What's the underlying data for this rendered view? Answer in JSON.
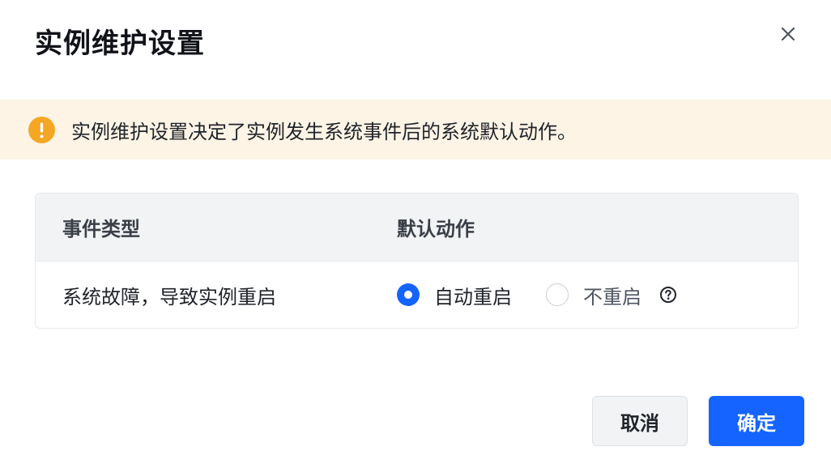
{
  "dialog": {
    "title": "实例维护设置",
    "close_icon": "close-icon"
  },
  "alert": {
    "icon": "warning-icon",
    "color": "#f5a623",
    "background": "#fdf4e6",
    "text": "实例维护设置决定了实例发生系统事件后的系统默认动作。"
  },
  "table": {
    "headers": [
      "事件类型",
      "默认动作"
    ],
    "rows": [
      {
        "event_type": "系统故障，导致实例重启",
        "options": [
          {
            "label": "自动重启",
            "checked": true
          },
          {
            "label": "不重启",
            "checked": false
          }
        ],
        "help_icon": "question-circle-icon"
      }
    ]
  },
  "footer": {
    "cancel_label": "取消",
    "confirm_label": "确定"
  },
  "colors": {
    "accent": "#1664ff",
    "warning": "#f5a623"
  }
}
